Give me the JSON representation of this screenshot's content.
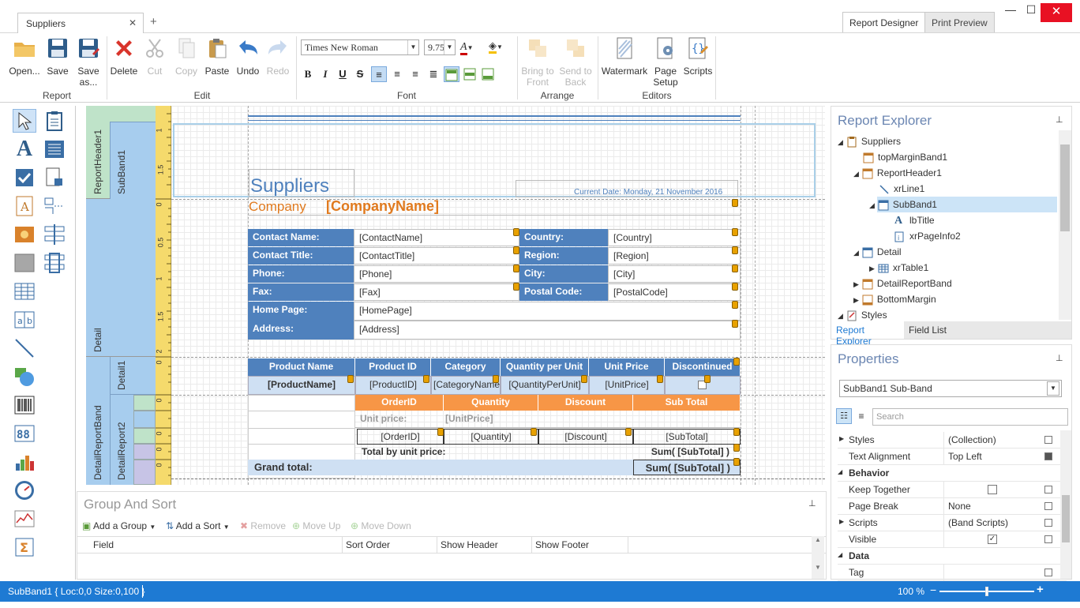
{
  "window": {
    "doc_tab": "Suppliers",
    "close_tab": "✕",
    "new_tab": "+",
    "minimize": "—",
    "maximize": "☐",
    "close": "✕",
    "mode_tabs": [
      "Report Designer",
      "Print Preview"
    ]
  },
  "ribbon": {
    "report_group": "Report",
    "edit_group": "Edit",
    "font_group": "Font",
    "arrange_group": "Arrange",
    "editors_group": "Editors",
    "open": "Open...",
    "save": "Save",
    "save_as_1": "Save",
    "save_as_2": "as...",
    "delete": "Delete",
    "cut": "Cut",
    "copy": "Copy",
    "paste": "Paste",
    "undo": "Undo",
    "redo": "Redo",
    "font_name": "Times New Roman",
    "font_size": "9.75",
    "bold": "B",
    "italic": "I",
    "underline": "U",
    "strike": "S",
    "bring_1": "Bring to",
    "bring_2": "Front",
    "send_1": "Send to",
    "send_2": "Back",
    "watermark": "Watermark",
    "page_setup_1": "Page",
    "page_setup_2": "Setup",
    "scripts": "Scripts"
  },
  "bands": {
    "report_header": "ReportHeader1",
    "subband": "SubBand1",
    "detail": "Detail",
    "detail_report": "DetailReportBand",
    "detail1": "Detail1",
    "detail_report2": "DetailReport2"
  },
  "ruler": [
    "1",
    "1.5",
    "0",
    "0.5",
    "1",
    "1.5",
    "2",
    "0",
    "0",
    "0",
    "0",
    "0"
  ],
  "report": {
    "title": "Suppliers",
    "current_date": "Current Date: Monday, 21 November 2016",
    "company_label": "Company",
    "company_field": "[CompanyName]",
    "left_labels": [
      "Contact Name:",
      "Contact Title:",
      "Phone:",
      "Fax:",
      "Home Page:",
      "Address:"
    ],
    "left_fields": [
      "[ContactName]",
      "[ContactTitle]",
      "[Phone]",
      "[Fax]",
      "[HomePage]",
      "[Address]"
    ],
    "right_labels": [
      "Country:",
      "Region:",
      "City:",
      "Postal Code:"
    ],
    "right_fields": [
      "[Country]",
      "[Region]",
      "[City]",
      "[PostalCode]"
    ],
    "product_headers": [
      "Product Name",
      "Product ID",
      "Category",
      "Quantity per Unit",
      "Unit Price",
      "Discontinued"
    ],
    "product_fields": [
      "[ProductName]",
      "[ProductID]",
      "[CategoryName]",
      "[QuantityPerUnit]",
      "[UnitPrice]"
    ],
    "order_headers": [
      "OrderID",
      "Quantity",
      "Discount",
      "Sub Total"
    ],
    "unit_price_label": "Unit price:",
    "unit_price_field": "[UnitPrice]",
    "order_fields": [
      "[OrderID]",
      "[Quantity]",
      "[Discount]",
      "[SubTotal]"
    ],
    "total_by_unit": "Total by unit price:",
    "sum_subtotal": "Sum( [SubTotal] )",
    "grand_total": "Grand total:",
    "grand_sum": "Sum( [SubTotal] )"
  },
  "explorer": {
    "title": "Report Explorer",
    "items": [
      "Suppliers",
      "topMarginBand1",
      "ReportHeader1",
      "xrLine1",
      "SubBand1",
      "lbTitle",
      "xrPageInfo2",
      "Detail",
      "xrTable1",
      "DetailReportBand",
      "BottomMargin",
      "Styles"
    ],
    "tabs": [
      "Report Explorer",
      "Field List"
    ],
    "pin": "⊥"
  },
  "properties": {
    "title": "Properties",
    "selector": "SubBand1  Sub-Band",
    "search_placeholder": "Search",
    "rows": [
      {
        "name": "Styles",
        "value": "(Collection)"
      },
      {
        "name": "Text Alignment",
        "value": "Top Left"
      },
      {
        "name": "Behavior",
        "value": ""
      },
      {
        "name": "Keep Together",
        "value": ""
      },
      {
        "name": "Page Break",
        "value": "None"
      },
      {
        "name": "Scripts",
        "value": "(Band Scripts)"
      },
      {
        "name": "Visible",
        "value": ""
      },
      {
        "name": "Data",
        "value": ""
      },
      {
        "name": "Tag",
        "value": ""
      }
    ]
  },
  "group_sort": {
    "title": "Group And Sort",
    "add_group": "Add a Group",
    "add_sort": "Add a Sort",
    "remove": "Remove",
    "move_up": "Move Up",
    "move_down": "Move Down",
    "columns": [
      "Field",
      "Sort Order",
      "Show Header",
      "Show Footer"
    ]
  },
  "status": {
    "text": "SubBand1 { Loc:0,0 Size:0,100 }",
    "zoom": "100 %",
    "zoom_level": 0.5
  }
}
